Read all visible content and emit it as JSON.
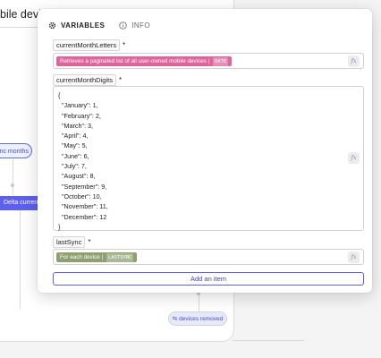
{
  "background": {
    "title": "bile devices",
    "node_sync": "ync months",
    "node_delta": "Delta currentM",
    "node_removed": "devices removed"
  },
  "tabs": [
    {
      "label": "VARIABLES",
      "icon": "gear-icon",
      "active": true
    },
    {
      "label": "INFO",
      "icon": "info-icon",
      "active": false
    }
  ],
  "fields": {
    "current_month_letters": {
      "label": "currentMonthLetters",
      "required": "*",
      "chip_text": "Retrieves a paginated list of all user-owned mobile devices",
      "chip_tag": "DATE",
      "fx": "fx"
    },
    "current_month_digits": {
      "label": "currentMonthDigits",
      "required": "*",
      "lines": [
        "{",
        "  \"January\": 1,",
        "  \"February\": 2,",
        "  \"March\": 3,",
        "  \"April\": 4,",
        "  \"May\": 5,",
        "  \"June\": 6,",
        "  \"July\": 7,",
        "  \"August\": 8,",
        "  \"September\": 9,",
        "  \"October\": 10,",
        "  \"November\": 11,",
        "  \"December\": 12",
        "}"
      ],
      "fx": "fx"
    },
    "last_sync": {
      "label": "lastSync",
      "required": "*",
      "chip_text": "For each device",
      "chip_tag": "LASTSYNC",
      "fx": "fx"
    }
  },
  "add_button": "Add an item",
  "colors": {
    "accent": "#5c5ff0",
    "pink_chip": "#e0649c",
    "green_chip": "#8ea070"
  }
}
